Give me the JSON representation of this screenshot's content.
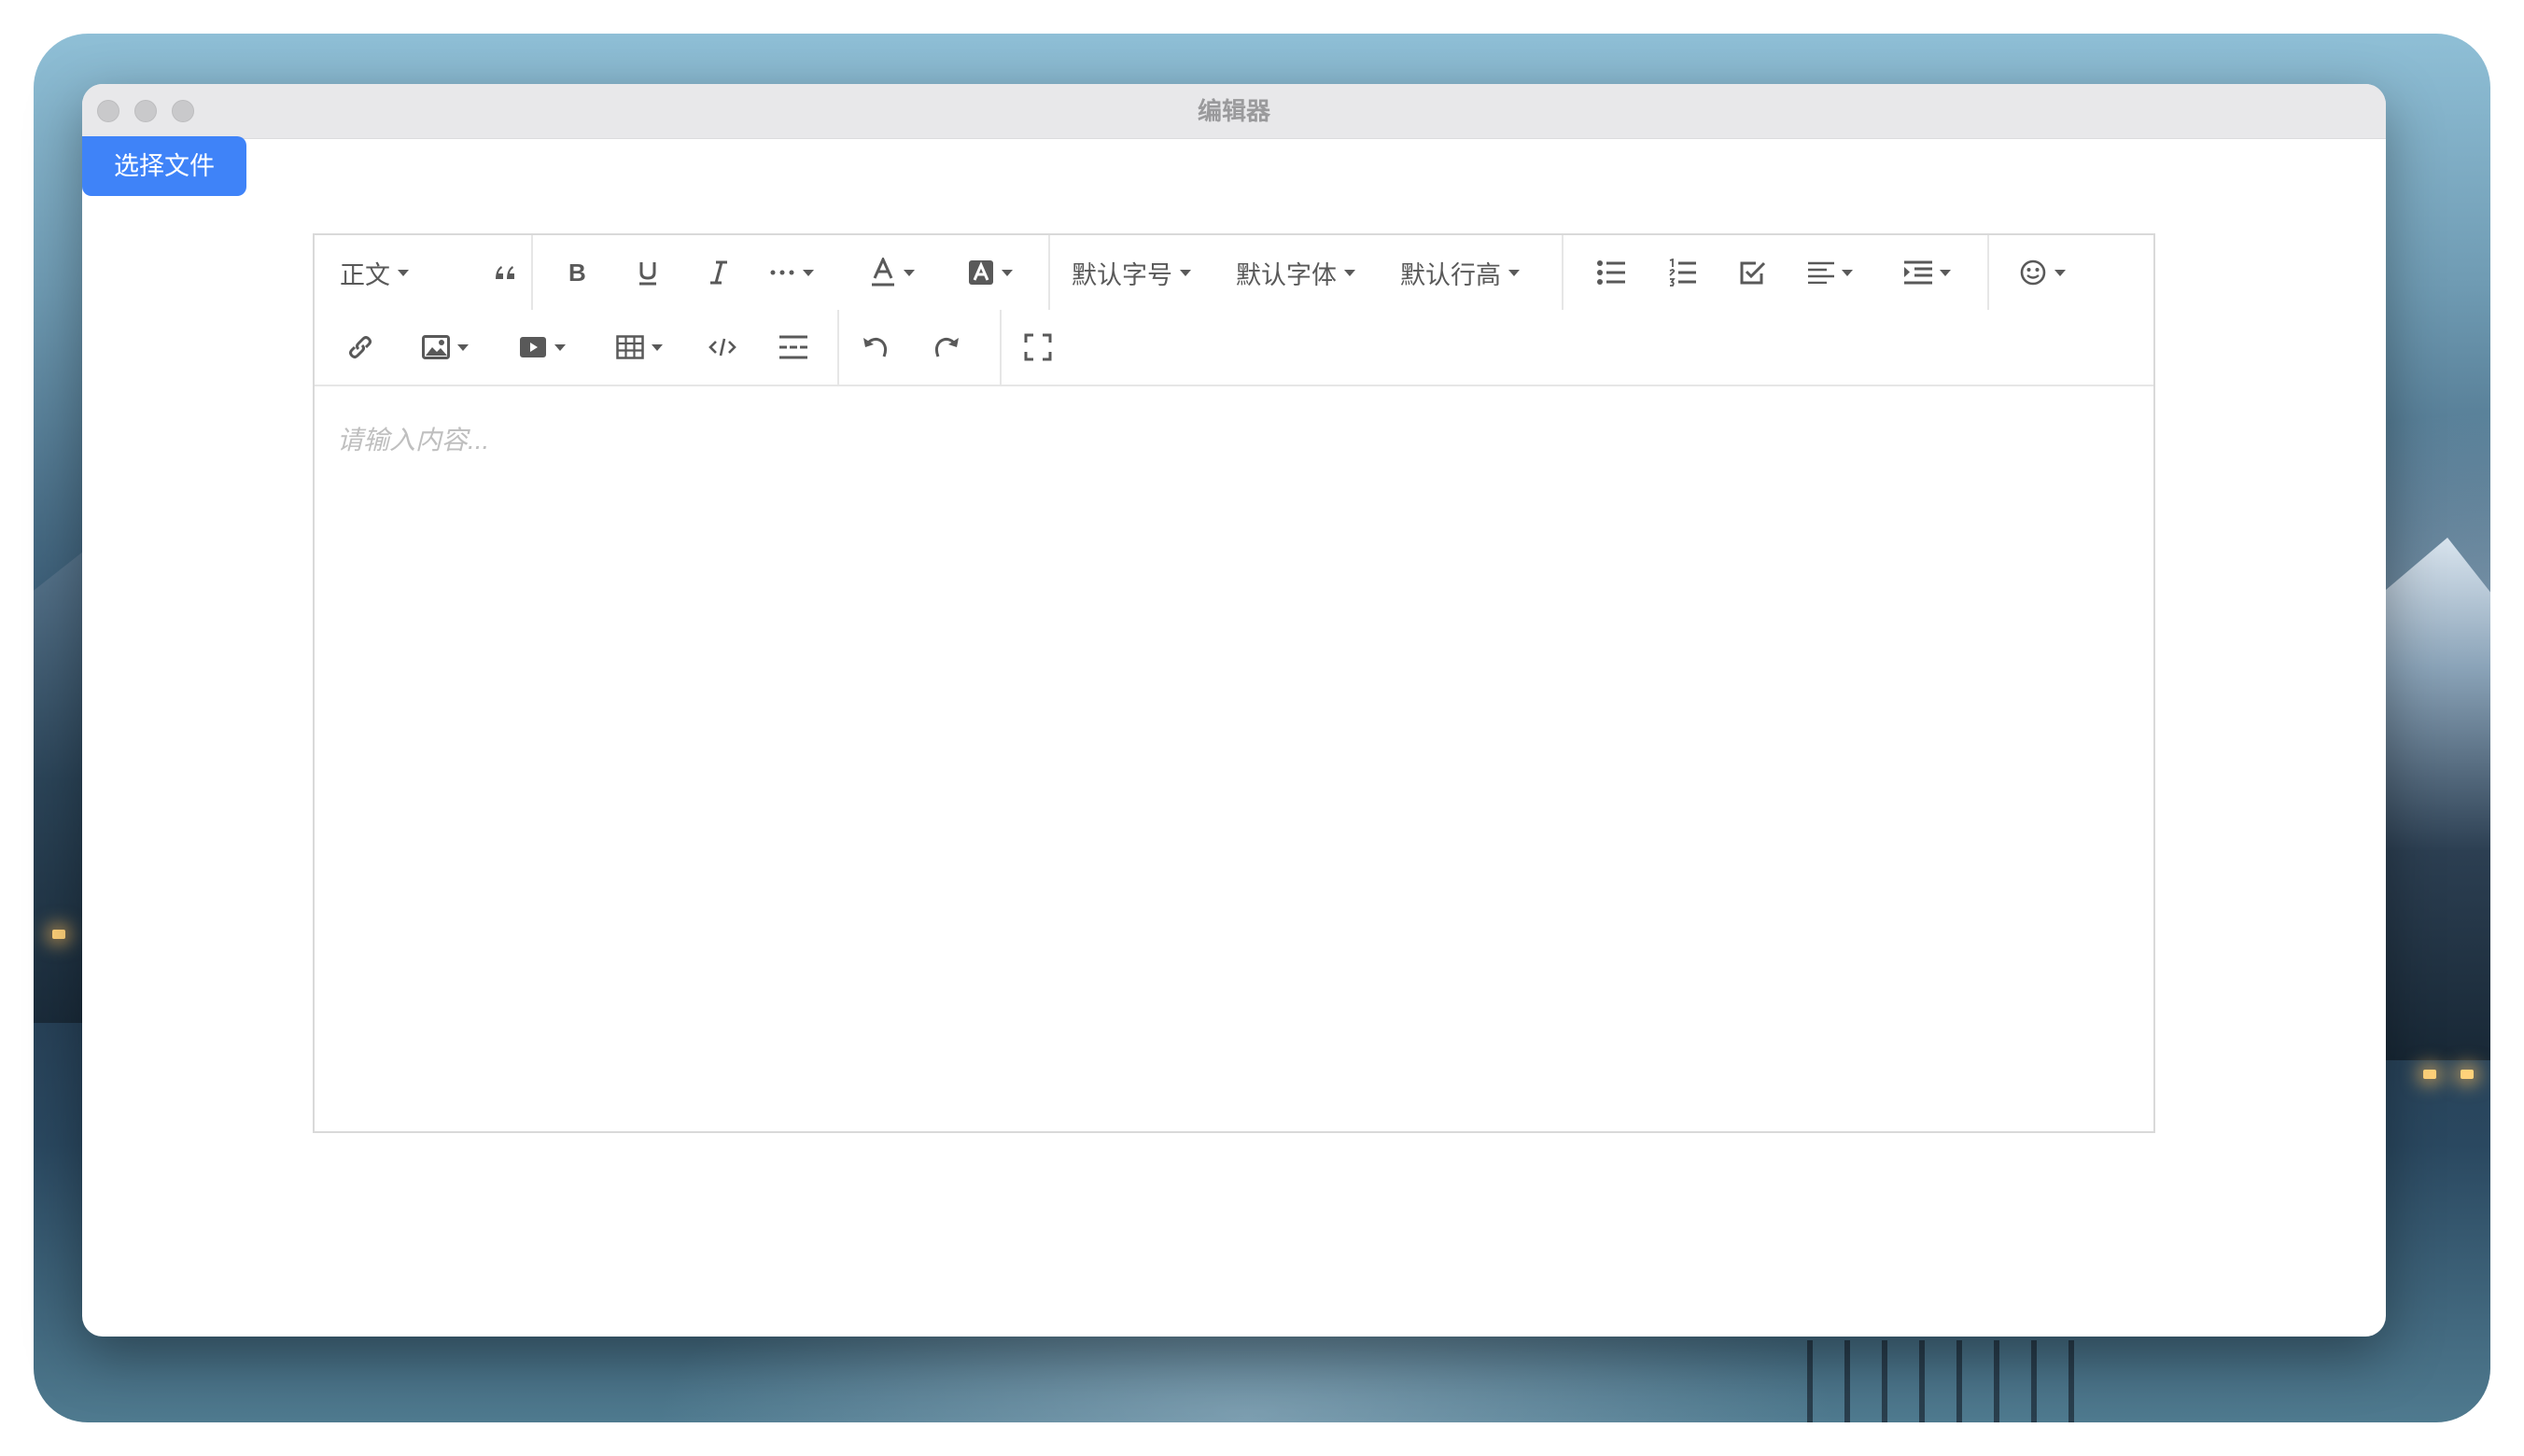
{
  "window": {
    "title": "编辑器"
  },
  "actions": {
    "select_file_label": "选择文件"
  },
  "toolbar": {
    "row1": [
      {
        "id": "heading",
        "label": "正文",
        "dropdown": true
      },
      {
        "id": "blockquote",
        "icon": "quote-icon"
      },
      {
        "id": "bold",
        "icon": "bold-icon"
      },
      {
        "id": "underline",
        "icon": "underline-icon"
      },
      {
        "id": "italic",
        "icon": "italic-icon"
      },
      {
        "id": "more-styles",
        "icon": "more-icon",
        "dropdown": true
      },
      {
        "id": "font-color",
        "icon": "font-color-icon",
        "dropdown": true
      },
      {
        "id": "bg-color",
        "icon": "background-color-icon",
        "dropdown": true
      },
      {
        "id": "font-size",
        "label": "默认字号",
        "dropdown": true
      },
      {
        "id": "font-family",
        "label": "默认字体",
        "dropdown": true
      },
      {
        "id": "line-height",
        "label": "默认行高",
        "dropdown": true
      },
      {
        "id": "bulleted-list",
        "icon": "bulleted-list-icon"
      },
      {
        "id": "numbered-list",
        "icon": "numbered-list-icon"
      },
      {
        "id": "todo",
        "icon": "checkbox-icon"
      },
      {
        "id": "align",
        "icon": "align-left-icon",
        "dropdown": true
      },
      {
        "id": "indent",
        "icon": "indent-icon",
        "dropdown": true
      },
      {
        "id": "emotion",
        "icon": "emoji-icon",
        "dropdown": true
      }
    ],
    "row2": [
      {
        "id": "link",
        "icon": "link-icon"
      },
      {
        "id": "image",
        "icon": "image-icon",
        "dropdown": true
      },
      {
        "id": "video",
        "icon": "video-icon",
        "dropdown": true
      },
      {
        "id": "table",
        "icon": "table-icon",
        "dropdown": true
      },
      {
        "id": "code-block",
        "icon": "code-icon"
      },
      {
        "id": "divider",
        "icon": "divider-icon"
      },
      {
        "id": "undo",
        "icon": "undo-icon"
      },
      {
        "id": "redo",
        "icon": "redo-icon"
      },
      {
        "id": "fullscreen",
        "icon": "fullscreen-icon"
      }
    ]
  },
  "editor": {
    "placeholder": "请输入内容..."
  }
}
